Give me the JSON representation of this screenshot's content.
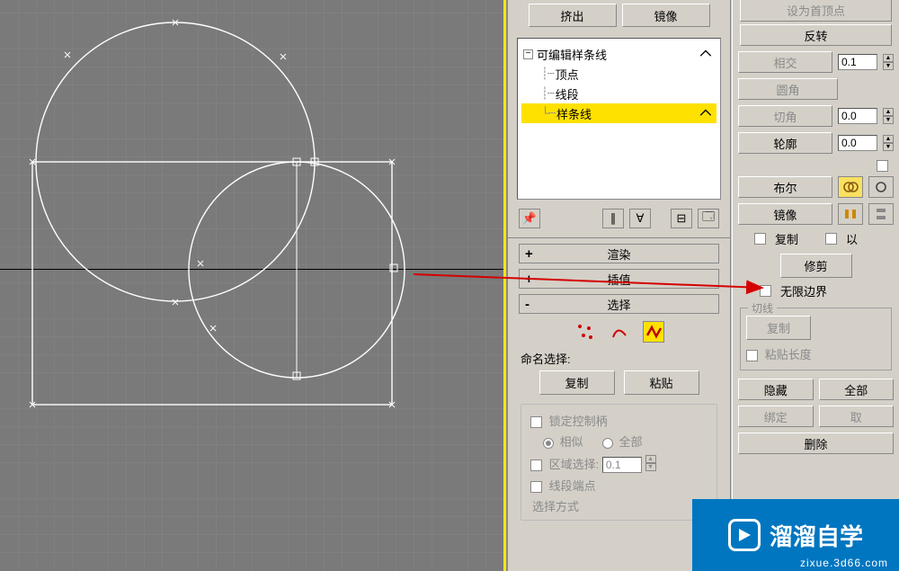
{
  "panel1": {
    "top_buttons": {
      "extrude": "挤出",
      "mirror": "镜像"
    },
    "tree": {
      "root": "可编辑样条线",
      "items": [
        "顶点",
        "线段",
        "样条线"
      ],
      "root_icon": "⌵",
      "spline_icon": "⌵"
    },
    "rollouts": {
      "render": "渲染",
      "interp": "插值",
      "select": "选择"
    },
    "name_sel_label": "命名选择:",
    "name_sel_buttons": {
      "copy": "复制",
      "paste": "粘贴"
    },
    "lock_group": {
      "lock_handles": "锁定控制柄",
      "similar": "相似",
      "all": "全部",
      "region_sel": "区域选择:",
      "region_val": "0.1",
      "seg_end": "线段端点",
      "sel_mode": "选择方式"
    }
  },
  "panel2": {
    "top_hidden": "设为首顶点",
    "reverse": "反转",
    "intersect": "相交",
    "intersect_val": "0.1",
    "fillet": "圆角",
    "chamfer": "切角",
    "chamfer_val": "0.0",
    "outline": "轮廓",
    "outline_val": "0.0",
    "bool": "布尔",
    "mirror": "镜像",
    "copy_chk": "复制",
    "about_chk": "以",
    "trim": "修剪",
    "inf_bound": "无限边界",
    "tangent_grp": "切线",
    "tan_copy": "复制",
    "tan_len": "粘贴长度",
    "hide": "隐藏",
    "all": "全部",
    "bind": "绑定",
    "pick": "取",
    "delete": "删除"
  },
  "watermark": {
    "brand": "溜溜自学",
    "url": "zixue.3d66.com"
  }
}
